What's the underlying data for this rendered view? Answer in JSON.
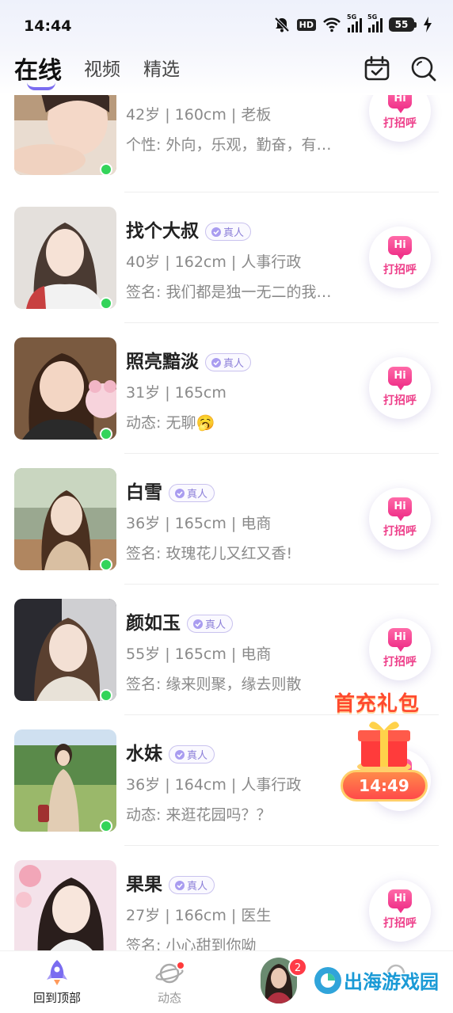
{
  "status_bar": {
    "time": "14:44",
    "hd": "HD",
    "signal1_label": "5G",
    "signal2_label": "5G",
    "battery": "55"
  },
  "tabs": [
    {
      "label": "在线"
    },
    {
      "label": "视频"
    },
    {
      "label": "精选"
    }
  ],
  "top_icons": [
    "calendar-check-icon",
    "search-icon"
  ],
  "badge_label": "真人",
  "greet_label": "打招呼",
  "greet_hi": "Hi",
  "users": [
    {
      "name": "",
      "info": "42岁 | 160cm | 老板",
      "sign": "个性: 外向，乐观，勤奋，有…",
      "online": true
    },
    {
      "name": "找个大叔",
      "info": "40岁 | 162cm | 人事行政",
      "sign": "签名: 我们都是独一无二的我…",
      "online": true
    },
    {
      "name": "照亮黯淡",
      "info": "31岁 | 165cm",
      "sign": "动态: 无聊🥱",
      "online": true
    },
    {
      "name": "白雪",
      "info": "36岁 | 165cm | 电商",
      "sign": "签名: 玫瑰花儿又红又香!",
      "online": true
    },
    {
      "name": "颜如玉",
      "info": "55岁 | 165cm | 电商",
      "sign": "签名: 缘来则聚，缘去则散",
      "online": true
    },
    {
      "name": "水妹",
      "info": "36岁 | 164cm | 人事行政",
      "sign": "动态: 来逛花园吗？？",
      "online": true
    },
    {
      "name": "果果",
      "info": "27岁 | 166cm | 医生",
      "sign": "签名: 小心甜到你呦",
      "online": true
    }
  ],
  "promo": {
    "title": "首充礼包",
    "timer": "14:49"
  },
  "bottom_nav": [
    {
      "label": "回到顶部",
      "icon": "rocket-icon",
      "active": true
    },
    {
      "label": "动态",
      "icon": "planet-icon",
      "active": false
    },
    {
      "label": "",
      "icon": "message-avatar",
      "badge": "2"
    },
    {
      "label": "",
      "icon": "profile-icon"
    }
  ],
  "watermark": "出海游戏园",
  "colors": {
    "accent": "#7a6cf0",
    "greet_pink": "#ee3f8a",
    "online_green": "#33d45a",
    "promo_red": "#ff4a2e"
  }
}
